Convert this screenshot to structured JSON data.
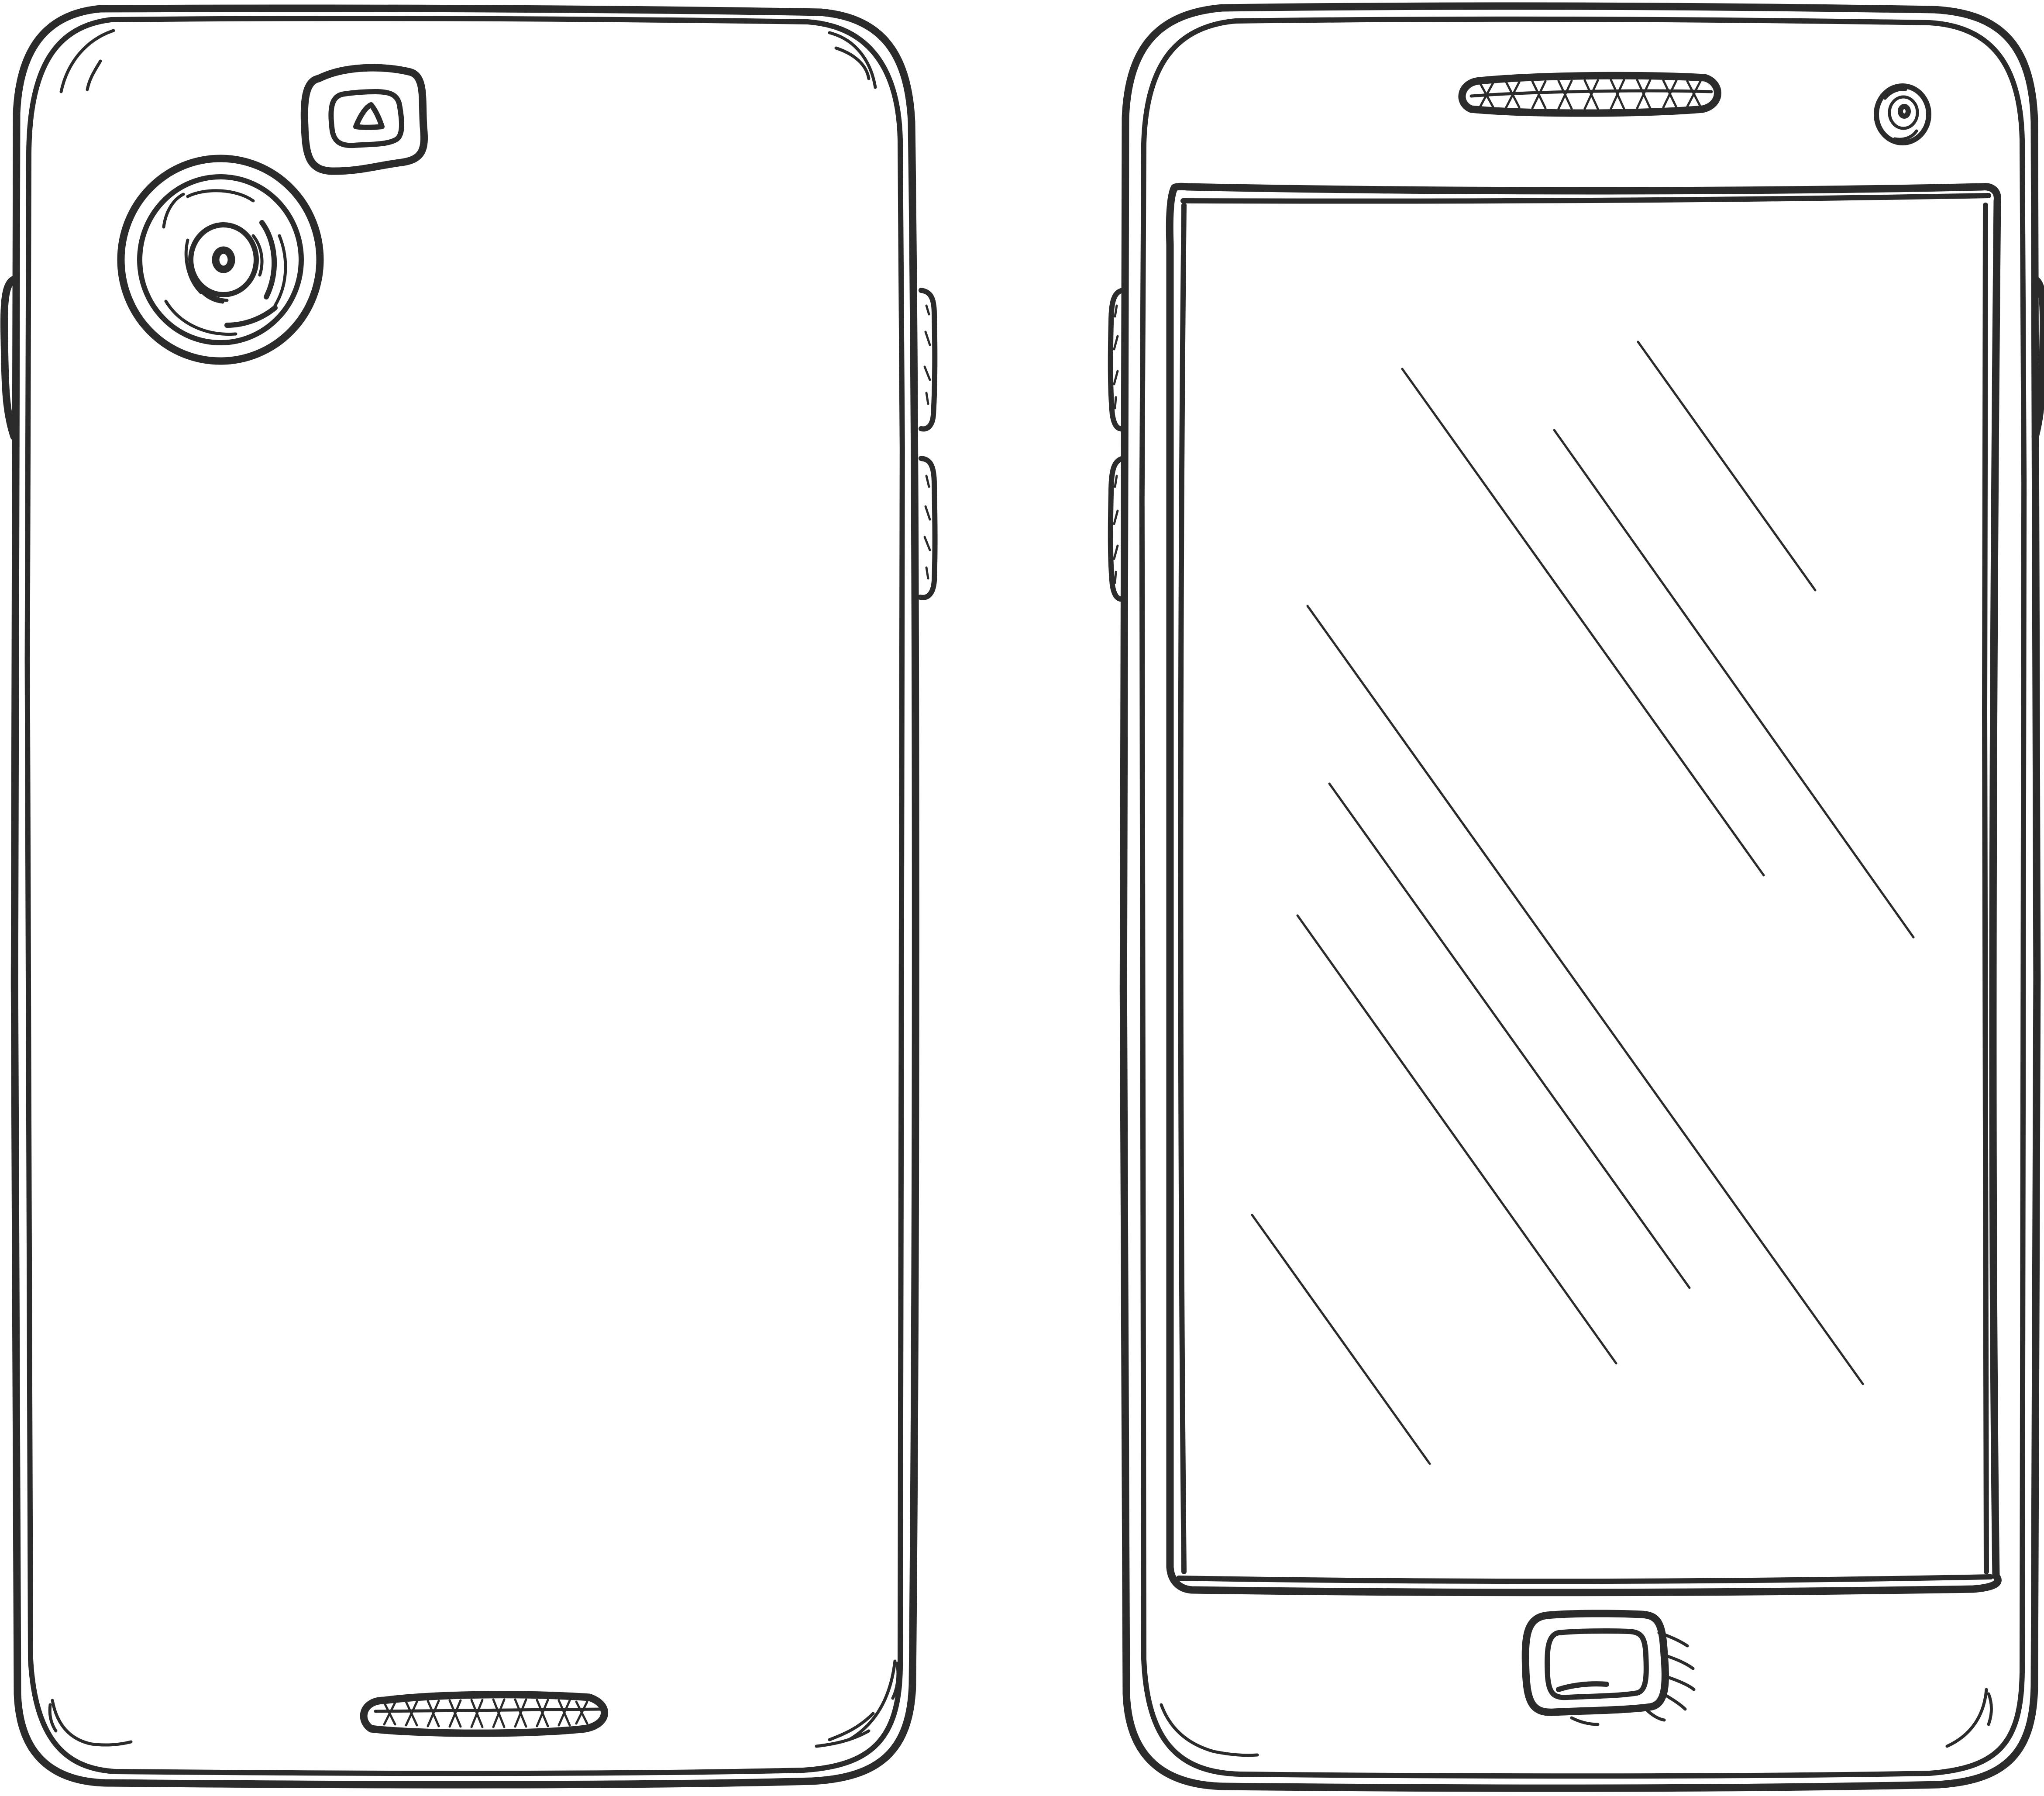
{
  "colors": {
    "ink": "#2b2b2b",
    "background": "#ffffff"
  },
  "phones": [
    {
      "view": "back",
      "icons": [
        "main-camera-lens-icon",
        "flash-icon",
        "speaker-grille-icon",
        "side-button-icon"
      ]
    },
    {
      "view": "front",
      "icons": [
        "earpiece-grille-icon",
        "front-camera-icon",
        "screen-icon",
        "screen-glare-icon",
        "home-button-icon",
        "side-button-icon"
      ]
    }
  ]
}
